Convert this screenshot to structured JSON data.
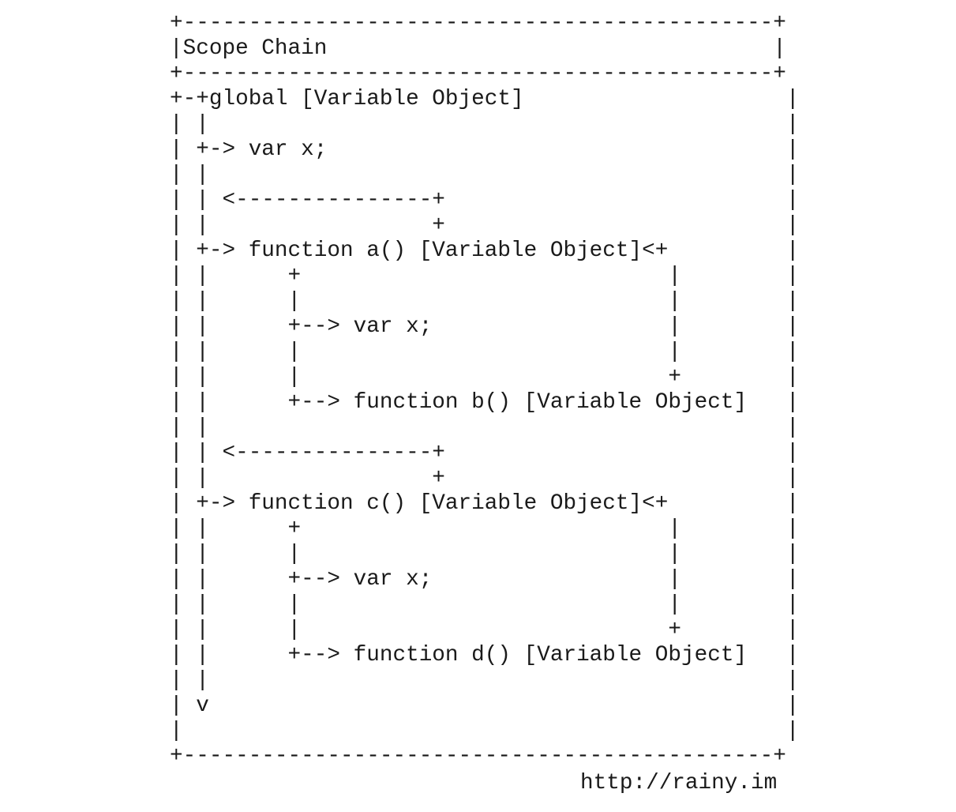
{
  "diagram": {
    "title": "Scope Chain",
    "lines": [
      "+---------------------------------------------+",
      "|Scope Chain                                  |",
      "+---------------------------------------------+",
      "+-+global [Variable Object]                    |",
      "| |                                            |",
      "| +-> var x;                                   |",
      "| |                                            |",
      "| | <---------------+                          |",
      "| |                 +                          |",
      "| +-> function a() [Variable Object]<+         |",
      "| |      +                            |        |",
      "| |      |                            |        |",
      "| |      +--> var x;                  |        |",
      "| |      |                            |        |",
      "| |      |                            +        |",
      "| |      +--> function b() [Variable Object]   |",
      "| |                                            |",
      "| | <---------------+                          |",
      "| |                 +                          |",
      "| +-> function c() [Variable Object]<+         |",
      "| |      +                            |        |",
      "| |      |                            |        |",
      "| |      +--> var x;                  |        |",
      "| |      |                            |        |",
      "| |      |                            +        |",
      "| |      +--> function d() [Variable Object]   |",
      "| |                                            |",
      "| v                                            |",
      "|                                              |",
      "+---------------------------------------------+"
    ]
  },
  "watermark": "http://rainy.im"
}
